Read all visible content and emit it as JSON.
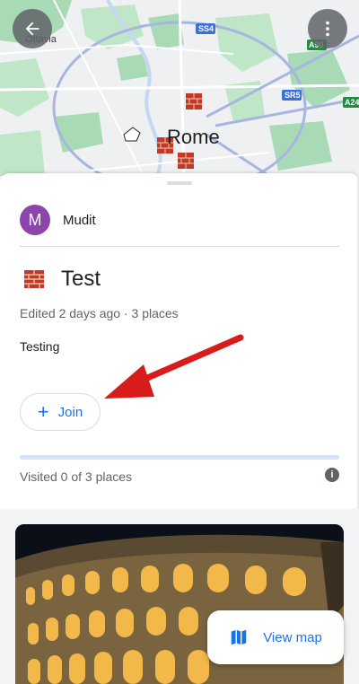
{
  "map": {
    "city_label": "Rome",
    "district_label": "Ottavia",
    "road_labels": [
      "SS4",
      "A90",
      "SR5",
      "A24"
    ]
  },
  "header": {
    "back_icon": "arrow-back-icon",
    "more_icon": "more-vert-icon"
  },
  "list": {
    "owner_initial": "M",
    "owner_name": "Mudit",
    "title": "Test",
    "title_icon": "brick-emoji-icon",
    "meta": "Edited 2 days ago · 3 places",
    "description": "Testing",
    "join_label": "Join",
    "visited_text": "Visited 0 of 3 places",
    "visited_fraction": 0
  },
  "photo": {
    "view_map_label": "View map"
  },
  "colors": {
    "accent": "#1a73e8",
    "avatar": "#8e44ad",
    "arrow": "#d81b1b"
  }
}
